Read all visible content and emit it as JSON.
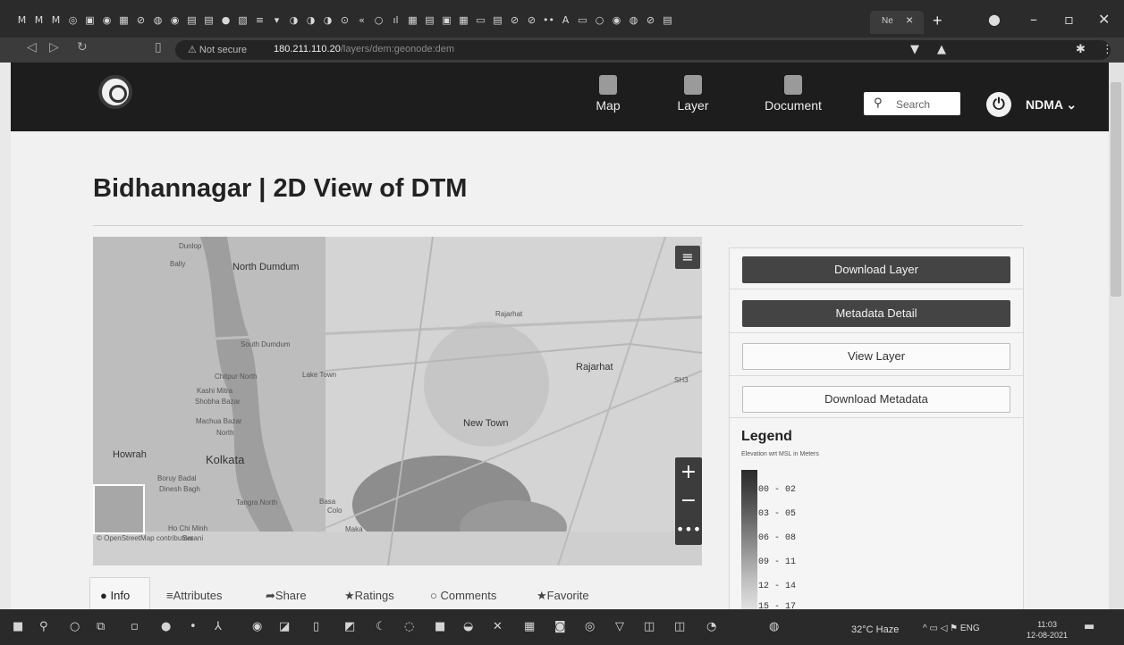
{
  "browser": {
    "tab_title": "Ne",
    "security_label": "Not secure",
    "url_host": "180.211.110.20",
    "url_path": "/layers/dem:geonode:dem"
  },
  "header": {
    "nav": [
      {
        "label": "Map"
      },
      {
        "label": "Layer"
      },
      {
        "label": "Document"
      }
    ],
    "search_placeholder": "Search",
    "user": "NDMA"
  },
  "page": {
    "title": "Bidhannagar | 2D View of DTM"
  },
  "map": {
    "labels": [
      "Dunlop",
      "Bally",
      "North Dumdum",
      "Rajarhat",
      "Rajarhat",
      "South Dumdum",
      "Chitpur North",
      "Lake Town",
      "Kashi Mitra",
      "Shobha Bazar",
      "Machua Bazar",
      "North",
      "New Town",
      "Howrah",
      "Kolkata",
      "Boruy Badal",
      "Dinesh Bagh",
      "Tangra North",
      "Basa",
      "Colo",
      "Ho Chi Minh",
      "Sarani",
      "Maka",
      "SH3"
    ],
    "attribution": "© OpenStreetMap contributors"
  },
  "tabs": [
    {
      "icon": "info-icon",
      "label": "Info"
    },
    {
      "icon": "list-icon",
      "label": "Attributes"
    },
    {
      "icon": "share-icon",
      "label": "Share"
    },
    {
      "icon": "star-icon",
      "label": "Ratings"
    },
    {
      "icon": "comment-icon",
      "label": "Comments"
    },
    {
      "icon": "star-icon",
      "label": "Favorite"
    }
  ],
  "panel": {
    "download_layer": "Download Layer",
    "metadata_detail": "Metadata Detail",
    "view_layer": "View Layer",
    "download_metadata": "Download Metadata"
  },
  "legend": {
    "title": "Legend",
    "subtitle": "Elevation wrt MSL in Meters",
    "items": [
      "00 - 02",
      "03 - 05",
      "06 - 08",
      "09 - 11",
      "12 - 14",
      "15 - 17"
    ]
  },
  "taskbar": {
    "weather": "32°C Haze",
    "lang": "ENG",
    "time": "11:03",
    "date": "12-08-2021"
  }
}
